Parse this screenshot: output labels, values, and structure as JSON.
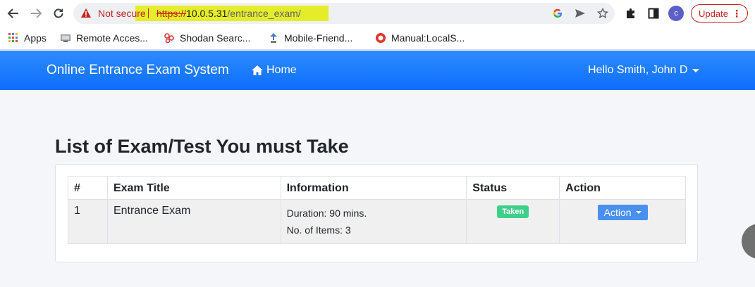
{
  "browser": {
    "security_label": "Not secure",
    "url_scheme": "https://",
    "url_host": "10.0.5.31",
    "url_path": "/entrance_exam/",
    "profile_initial": "c",
    "update_label": "Update",
    "bookmarks": [
      {
        "label": "Apps",
        "icon": "apps-grid-icon"
      },
      {
        "label": "Remote Acces...",
        "icon": "remote-access-icon"
      },
      {
        "label": "Shodan Searc...",
        "icon": "shodan-icon"
      },
      {
        "label": "Mobile-Friend...",
        "icon": "mobile-friendly-icon"
      },
      {
        "label": "Manual:LocalS...",
        "icon": "manual-icon"
      }
    ]
  },
  "navbar": {
    "brand": "Online Entrance Exam System",
    "home_label": "Home",
    "user_greeting": "Hello Smith, John D"
  },
  "main": {
    "title": "List of Exam/Test You must Take",
    "table": {
      "headers": [
        "#",
        "Exam Title",
        "Information",
        "Status",
        "Action"
      ],
      "rows": [
        {
          "num": "1",
          "title": "Entrance Exam",
          "duration": "Duration: 90 mins.",
          "items": "No. of Items: 3",
          "status": "Taken",
          "action": "Action"
        }
      ]
    }
  },
  "colors": {
    "navbar": "#0d6efd",
    "badge": "#3ed08a",
    "action_button": "#4a90f0",
    "url_highlight": "#e5ec2a",
    "warning": "#c5221f"
  }
}
